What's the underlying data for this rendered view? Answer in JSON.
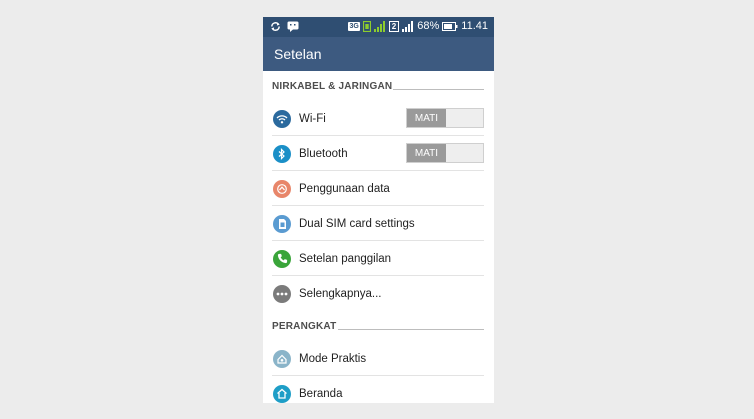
{
  "status_bar": {
    "network_badge": "3G",
    "sim_badge": "2",
    "battery_percent": "68%",
    "time": "11.41"
  },
  "app_bar": {
    "title": "Setelan"
  },
  "sections": {
    "wireless": {
      "header": "NIRKABEL & JARINGAN",
      "wifi": {
        "label": "Wi-Fi",
        "toggle": "MATI"
      },
      "bluetooth": {
        "label": "Bluetooth",
        "toggle": "MATI"
      },
      "data_usage": {
        "label": "Penggunaan data"
      },
      "dual_sim": {
        "label": "Dual SIM card settings"
      },
      "call_settings": {
        "label": "Setelan panggilan"
      },
      "more": {
        "label": "Selengkapnya..."
      }
    },
    "device": {
      "header": "PERANGKAT",
      "easy_mode": {
        "label": "Mode Praktis"
      },
      "home": {
        "label": "Beranda"
      }
    }
  },
  "colors": {
    "status_bar": "#2f4e72",
    "app_bar": "#3d5a80",
    "wifi_icon": "#2b6a9e",
    "bluetooth_icon": "#1a8fc7",
    "data_usage_icon": "#e8866a",
    "dual_sim_icon": "#5a9bd1",
    "call_icon": "#3aa53a",
    "more_icon": "#7b7b7b",
    "easy_mode_icon": "#8ab4c9",
    "home_icon": "#1e9ec7"
  }
}
